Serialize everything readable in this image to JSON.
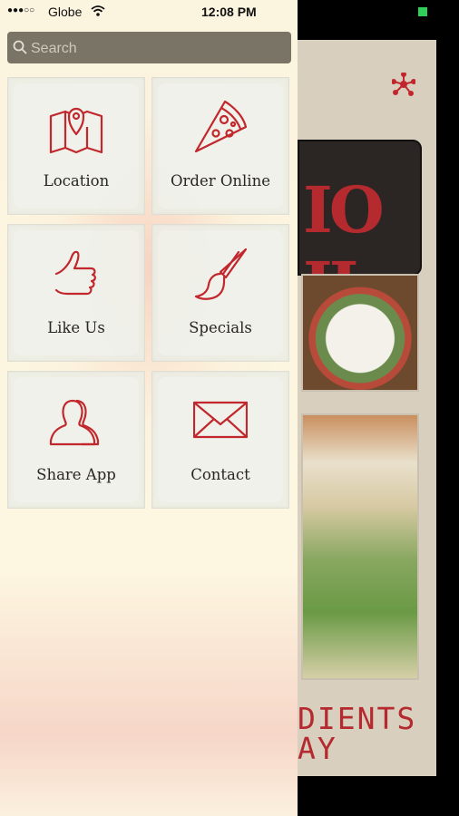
{
  "status_bar": {
    "signal": "●●●○○",
    "carrier": "Globe",
    "time": "12:08 PM"
  },
  "search": {
    "placeholder": "Search"
  },
  "menu": {
    "items": [
      {
        "label": "Location",
        "icon": "map-pin-icon"
      },
      {
        "label": "Order Online",
        "icon": "pizza-slice-icon"
      },
      {
        "label": "Like Us",
        "icon": "thumbs-up-icon"
      },
      {
        "label": "Specials",
        "icon": "paintbrush-icon"
      },
      {
        "label": "Share App",
        "icon": "people-icon"
      },
      {
        "label": "Contact",
        "icon": "envelope-icon"
      }
    ]
  },
  "background": {
    "sign_text": "IO II",
    "tagline": "DIENTS\nAY"
  },
  "colors": {
    "accent": "#c1272d",
    "search_bg": "#7a7466",
    "drawer_bg": "#fdf6e0"
  }
}
